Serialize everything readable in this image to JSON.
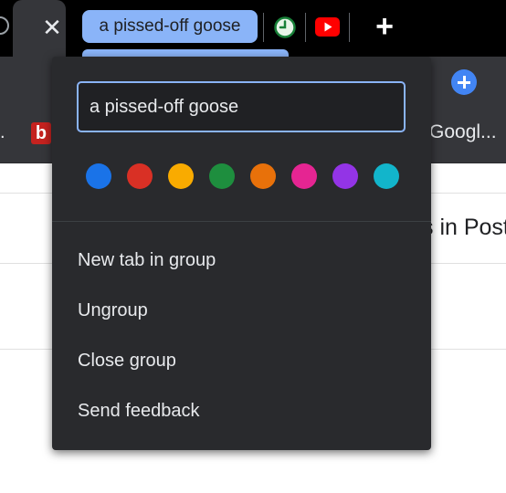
{
  "tab_strip": {
    "active_tab_close": "✕",
    "group_chip_label": "a pissed-off goose",
    "new_tab": "+"
  },
  "toolbar": {
    "menu_glyph": "⋮"
  },
  "bookmarks": {
    "leading_glyph": ".",
    "b_icon_letter": "b",
    "google_label": "Googl..."
  },
  "page": {
    "card_text": "s in Post"
  },
  "group_editor": {
    "title_value": "a pissed-off goose",
    "colors": [
      {
        "name": "blue",
        "hex": "#1a73e8"
      },
      {
        "name": "red",
        "hex": "#d93025"
      },
      {
        "name": "yellow",
        "hex": "#f9ab00"
      },
      {
        "name": "green",
        "hex": "#1e8e3e"
      },
      {
        "name": "orange",
        "hex": "#e8710a"
      },
      {
        "name": "pink",
        "hex": "#e52592"
      },
      {
        "name": "purple",
        "hex": "#9334e6"
      },
      {
        "name": "cyan",
        "hex": "#12b5cb"
      }
    ],
    "menu_items": [
      {
        "label": "New tab in group"
      },
      {
        "label": "Ungroup"
      },
      {
        "label": "Close group"
      },
      {
        "label": "Send feedback"
      }
    ]
  },
  "colors": {
    "tabstrip_bg": "#000000",
    "toolbar_bg": "#35363a",
    "bubble_bg": "#292a2d",
    "group_accent": "#8ab4f8"
  }
}
